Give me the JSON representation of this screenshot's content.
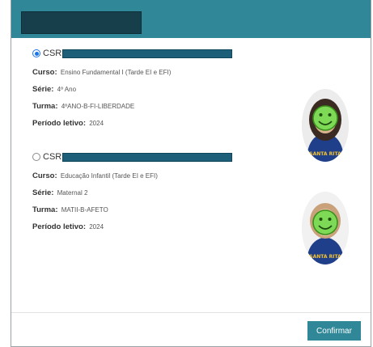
{
  "students": [
    {
      "selected": true,
      "name_prefix": "CSR",
      "course_label": "Curso:",
      "course_value": "Ensino Fundamental I (Tarde EI e EFI)",
      "grade_label": "Série:",
      "grade_value": "4º Ano",
      "class_label": "Turma:",
      "class_value": "4ºANO-B-FI-LIBERDADE",
      "period_label": "Período letivo:",
      "period_value": "2024"
    },
    {
      "selected": false,
      "name_prefix": "CSR",
      "course_label": "Curso:",
      "course_value": "Educação Infantil (Tarde EI e EFI)",
      "grade_label": "Série:",
      "grade_value": "Maternal 2",
      "class_label": "Turma:",
      "class_value": "MATII-B-AFETO",
      "period_label": "Período letivo:",
      "period_value": "2024"
    }
  ],
  "footer": {
    "confirm_label": "Confirmar"
  },
  "colors": {
    "header": "#2f8797",
    "button": "#2f8797",
    "redaction": "#1d5f78",
    "radio_selected": "#1a73e8"
  }
}
